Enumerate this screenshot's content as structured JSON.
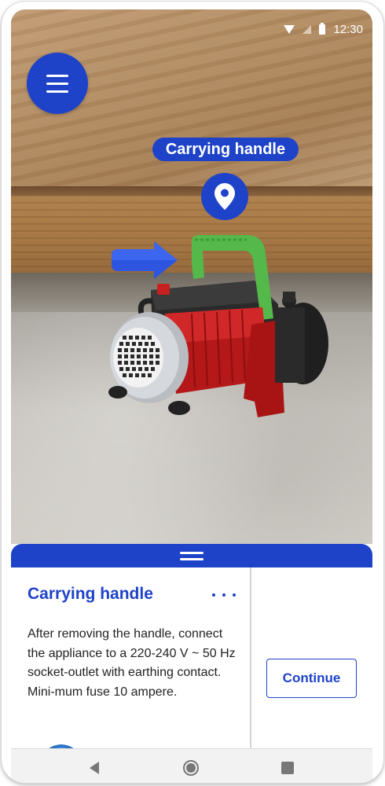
{
  "status_bar": {
    "time": "12:30",
    "icons": [
      "wifi-icon",
      "signal-icon",
      "battery-icon"
    ]
  },
  "ar_view": {
    "callout_label": "Carrying handle",
    "menu_icon": "hamburger-menu-icon",
    "pin_icon": "location-pin-icon",
    "arrow_icon": "pointer-arrow-icon",
    "object": "pump-model"
  },
  "sheet": {
    "title": "Carrying handle",
    "more_icon": "more-horizontal-icon",
    "body": "After removing the handle, connect the appliance to a 220-240 V ~ 50 Hz socket-outlet with earthing contact. Mini-mum fuse 10 ampere.",
    "continue_label": "Continue"
  },
  "nav_bar": {
    "icons": [
      "back-icon",
      "home-icon",
      "recent-apps-icon"
    ]
  },
  "colors": {
    "accent": "#1e42c8",
    "highlight": "#4caf50"
  }
}
